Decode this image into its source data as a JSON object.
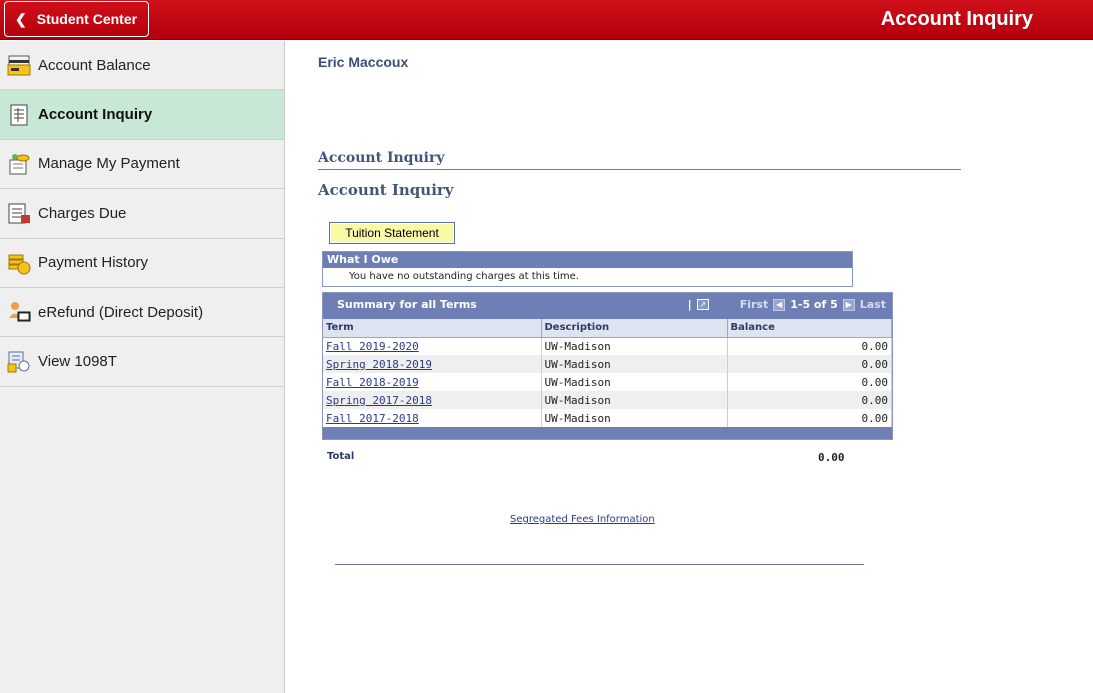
{
  "header": {
    "back_label": "Student Center",
    "title": "Account Inquiry",
    "colors": {
      "bar": "#c00010",
      "text": "#ffffff"
    }
  },
  "sidebar": {
    "items": [
      {
        "label": "Account Balance",
        "icon": "account-balance-icon",
        "active": false
      },
      {
        "label": "Account Inquiry",
        "icon": "account-inquiry-icon",
        "active": true
      },
      {
        "label": "Manage My Payment",
        "icon": "manage-payment-icon",
        "active": false
      },
      {
        "label": "Charges Due",
        "icon": "charges-due-icon",
        "active": false
      },
      {
        "label": "Payment History",
        "icon": "payment-history-icon",
        "active": false
      },
      {
        "label": "eRefund (Direct Deposit)",
        "icon": "erefund-icon",
        "active": false
      },
      {
        "label": "View 1098T",
        "icon": "view-1098t-icon",
        "active": false
      }
    ],
    "active_color": "#c8e8d5"
  },
  "main": {
    "student_name": "Eric Maccoux",
    "section_title": "Account Inquiry",
    "page_title": "Account Inquiry",
    "tuition_button": "Tuition Statement",
    "what_i_owe": {
      "title": "What I Owe",
      "message": "You have no outstanding charges at this time."
    },
    "summary": {
      "title": "Summary for all Terms",
      "nav": {
        "separator": "|",
        "first": "First",
        "range": "1-5 of 5",
        "last": "Last"
      },
      "columns": [
        "Term",
        "Description",
        "Balance"
      ],
      "rows": [
        {
          "term": "Fall 2019-2020",
          "description": "UW-Madison",
          "balance": "0.00"
        },
        {
          "term": "Spring 2018-2019",
          "description": "UW-Madison",
          "balance": "0.00"
        },
        {
          "term": "Fall 2018-2019",
          "description": "UW-Madison",
          "balance": "0.00"
        },
        {
          "term": "Spring 2017-2018",
          "description": "UW-Madison",
          "balance": "0.00"
        },
        {
          "term": "Fall 2017-2018",
          "description": "UW-Madison",
          "balance": "0.00"
        }
      ]
    },
    "total": {
      "label": "Total",
      "value": "0.00"
    },
    "segregated_fees_link": "Segregated Fees Information"
  }
}
